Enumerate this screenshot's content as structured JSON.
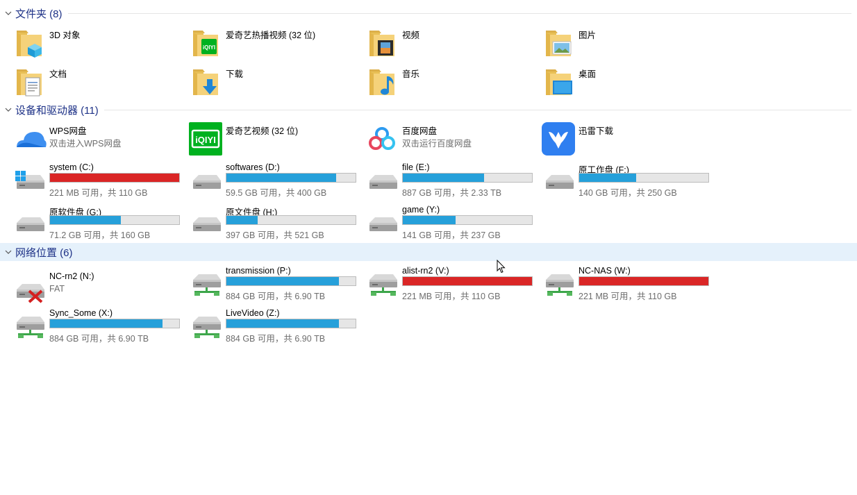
{
  "colors": {
    "header_text": "#1e3287",
    "bar_blue": "#26a0da",
    "bar_red": "#da2626",
    "muted": "#6d6d6d"
  },
  "groups": {
    "folders": {
      "title": "文件夹 (8)"
    },
    "devices": {
      "title": "设备和驱动器 (11)"
    },
    "network": {
      "title": "网络位置 (6)"
    }
  },
  "folders": [
    {
      "name": "3D 对象",
      "icon": "3d-objects-folder-icon"
    },
    {
      "name": "爱奇艺热播视频 (32 位)",
      "icon": "iqiyi-folder-icon"
    },
    {
      "name": "视频",
      "icon": "videos-folder-icon"
    },
    {
      "name": "图片",
      "icon": "pictures-folder-icon"
    },
    {
      "name": "文档",
      "icon": "documents-folder-icon"
    },
    {
      "name": "下载",
      "icon": "downloads-folder-icon"
    },
    {
      "name": "音乐",
      "icon": "music-folder-icon"
    },
    {
      "name": "桌面",
      "icon": "desktop-folder-icon"
    }
  ],
  "apps": [
    {
      "name": "WPS网盘",
      "sub": "双击进入WPS网盘",
      "icon": "wps-cloud-icon"
    },
    {
      "name": "爱奇艺视频 (32 位)",
      "sub": "",
      "icon": "iqiyi-icon"
    },
    {
      "name": "百度网盘",
      "sub": "双击运行百度网盘",
      "icon": "baidu-netdisk-icon"
    },
    {
      "name": "迅雷下载",
      "sub": "",
      "icon": "xunlei-icon"
    }
  ],
  "drives": [
    {
      "name": "system (C:)",
      "space": "221 MB 可用，共 110 GB",
      "used": 0.998,
      "status": "red",
      "icon": "windows-drive-icon"
    },
    {
      "name": "softwares (D:)",
      "space": "59.5 GB 可用，共 400 GB",
      "used": 0.85,
      "status": "blue",
      "icon": "drive-icon"
    },
    {
      "name": "file (E:)",
      "space": "887 GB 可用，共 2.33 TB",
      "used": 0.63,
      "status": "blue",
      "icon": "drive-icon"
    },
    {
      "name": "原工作盘 (F:)",
      "space": "140 GB 可用，共 250 GB",
      "used": 0.44,
      "status": "blue",
      "icon": "drive-icon"
    },
    {
      "name": "原软件盘 (G:)",
      "space": "71.2 GB 可用，共 160 GB",
      "used": 0.55,
      "status": "blue",
      "icon": "drive-icon"
    },
    {
      "name": "原文件盘 (H:)",
      "space": "397 GB 可用，共 521 GB",
      "used": 0.24,
      "status": "blue",
      "icon": "drive-icon"
    },
    {
      "name": "game (Y:)",
      "space": "141 GB 可用，共 237 GB",
      "used": 0.41,
      "status": "blue",
      "icon": "drive-icon"
    }
  ],
  "network": [
    {
      "name": "NC-rn2 (N:)",
      "sub": "FAT",
      "disconnected": true,
      "icon": "network-drive-disconnected-icon"
    },
    {
      "name": "transmission (P:)",
      "space": "884 GB 可用，共 6.90 TB",
      "used": 0.87,
      "status": "blue",
      "icon": "network-drive-icon"
    },
    {
      "name": "alist-rn2 (V:)",
      "space": "221 MB 可用，共 110 GB",
      "used": 0.998,
      "status": "red",
      "icon": "network-drive-icon"
    },
    {
      "name": "NC-NAS (W:)",
      "space": "221 MB 可用，共 110 GB",
      "used": 0.998,
      "status": "red",
      "icon": "network-drive-icon"
    },
    {
      "name": "Sync_Some (X:)",
      "space": "884 GB 可用，共 6.90 TB",
      "used": 0.87,
      "status": "blue",
      "icon": "network-drive-icon"
    },
    {
      "name": "LiveVideo (Z:)",
      "space": "884 GB 可用，共 6.90 TB",
      "used": 0.87,
      "status": "blue",
      "icon": "network-drive-icon"
    }
  ]
}
